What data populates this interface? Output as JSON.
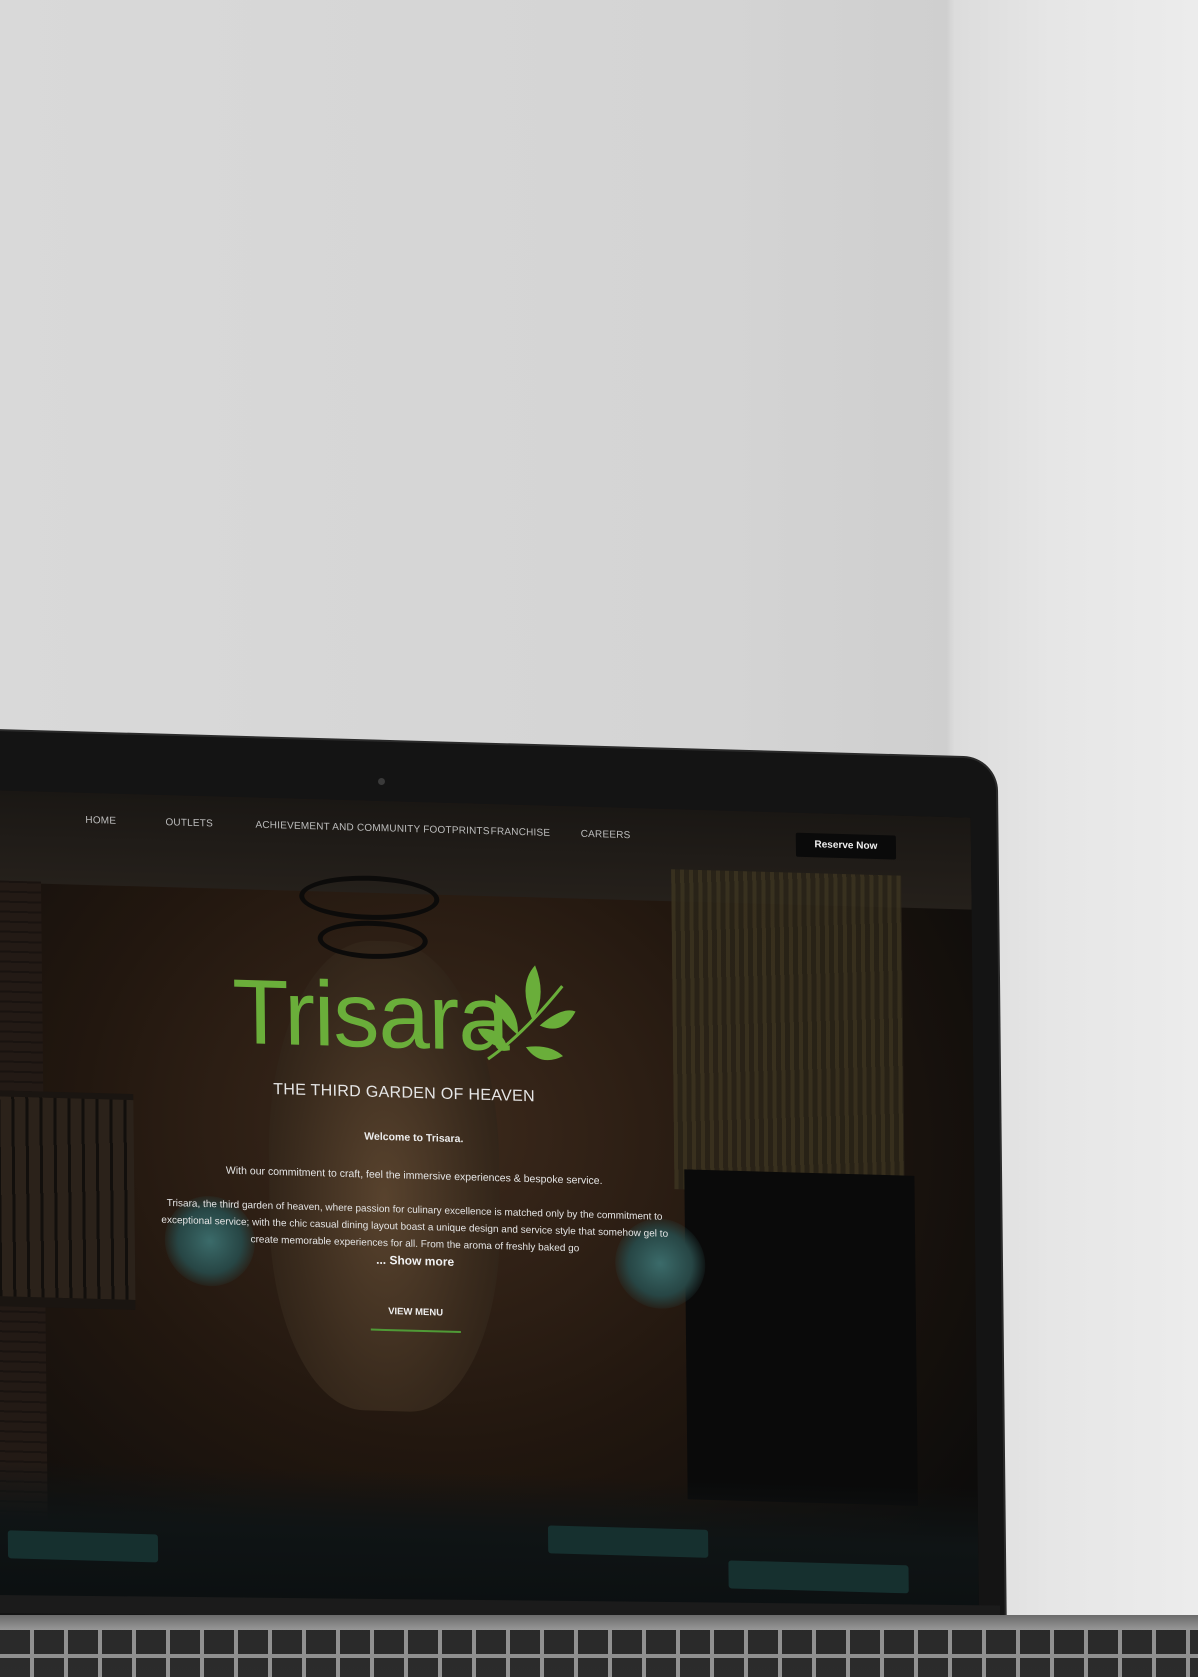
{
  "nav": {
    "items": [
      {
        "label": "HOME"
      },
      {
        "label": "OUTLETS"
      },
      {
        "label": "ACHIEVEMENT AND COMMUNITY FOOTPRINTS"
      },
      {
        "label": "FRANCHISE"
      },
      {
        "label": "CAREERS"
      }
    ],
    "reserve_label": "Reserve Now"
  },
  "hero": {
    "logo_text": "Trisara",
    "tagline": "THE THIRD GARDEN OF HEAVEN",
    "welcome": "Welcome to Trisara.",
    "commitment": "With our commitment to craft, feel the immersive experiences & bespoke service.",
    "description": "Trisara, the third garden of heaven, where passion for culinary excellence is matched only by the commitment to exceptional service; with the chic casual dining layout boast a unique design and service style that somehow gel to create memorable experiences for all. From the aroma of freshly baked go",
    "show_more": "... Show more",
    "view_menu": "VIEW MENU"
  },
  "colors": {
    "brand_green": "#6aae3a",
    "accent_underline": "#4f9a36",
    "button_bg": "#0a0a0a"
  },
  "icons": {
    "logo_leaf": "leaf-branch-icon",
    "camera": "webcam-icon"
  }
}
